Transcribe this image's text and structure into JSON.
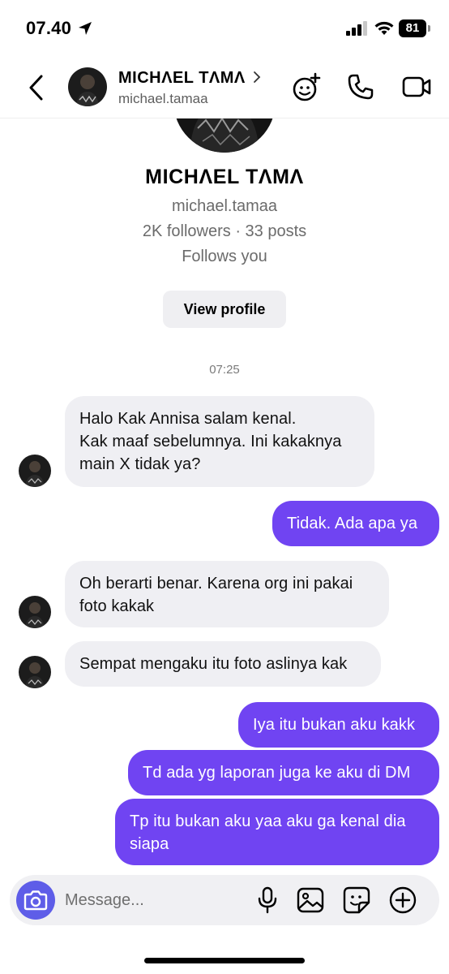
{
  "status_bar": {
    "time": "07.40",
    "battery": "81"
  },
  "header": {
    "name": "MICHΛEL TΛMΛ",
    "username": "michael.tamaa"
  },
  "profile": {
    "name": "MICHΛEL TΛMΛ",
    "username": "michael.tamaa",
    "stats": "2K followers · 33 posts",
    "follows": "Follows you",
    "view_profile_label": "View profile"
  },
  "conversation": {
    "timestamp": "07:25",
    "messages": [
      {
        "from": "them",
        "text": "Halo Kak Annisa salam kenal.\nKak maaf sebelumnya. Ini kakaknya main X tidak ya?"
      },
      {
        "from": "me",
        "text": "Tidak. Ada apa ya"
      },
      {
        "from": "them",
        "text": "Oh berarti benar. Karena org ini pakai foto kakak"
      },
      {
        "from": "them",
        "text": "Sempat mengaku itu foto aslinya kak"
      },
      {
        "from": "me",
        "text": "Iya itu bukan aku kakk"
      },
      {
        "from": "me",
        "text": "Td ada yg laporan juga ke aku di DM"
      },
      {
        "from": "me",
        "text": "Tp itu bukan aku yaa aku ga kenal dia siapa"
      }
    ]
  },
  "composer": {
    "placeholder": "Message..."
  },
  "colors": {
    "accent": "#7044f2",
    "camera": "#5e5de8",
    "incoming_bubble": "#efeff3"
  }
}
